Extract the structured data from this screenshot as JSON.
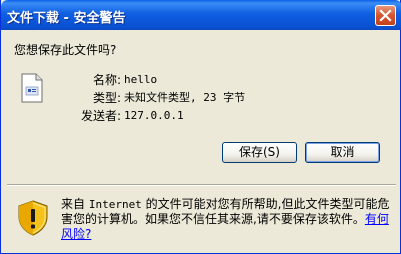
{
  "window": {
    "title": "文件下载 - 安全警告",
    "close_icon": "close-icon"
  },
  "question": "您想保存此文件吗?",
  "file": {
    "icon": "document-icon",
    "fields": [
      {
        "label": "名称:",
        "value": "hello"
      },
      {
        "label": "类型:",
        "value": "未知文件类型, 23 字节"
      },
      {
        "label": "发送者:",
        "value": "127.0.0.1"
      }
    ]
  },
  "buttons": {
    "save": "保存(S)",
    "cancel": "取消"
  },
  "warning": {
    "icon": "security-shield-icon",
    "text_part1": "来自 ",
    "text_internet": "Internet",
    "text_part2": " 的文件可能对您有所帮助,但此文件类型可能危害您的计算机。如果您不信任其来源,请不要保存该软件。",
    "link": "有何风险?"
  },
  "colors": {
    "titlebar": "#0A5FE6",
    "dialog_bg": "#ECE9D8",
    "link": "#0000FF"
  }
}
